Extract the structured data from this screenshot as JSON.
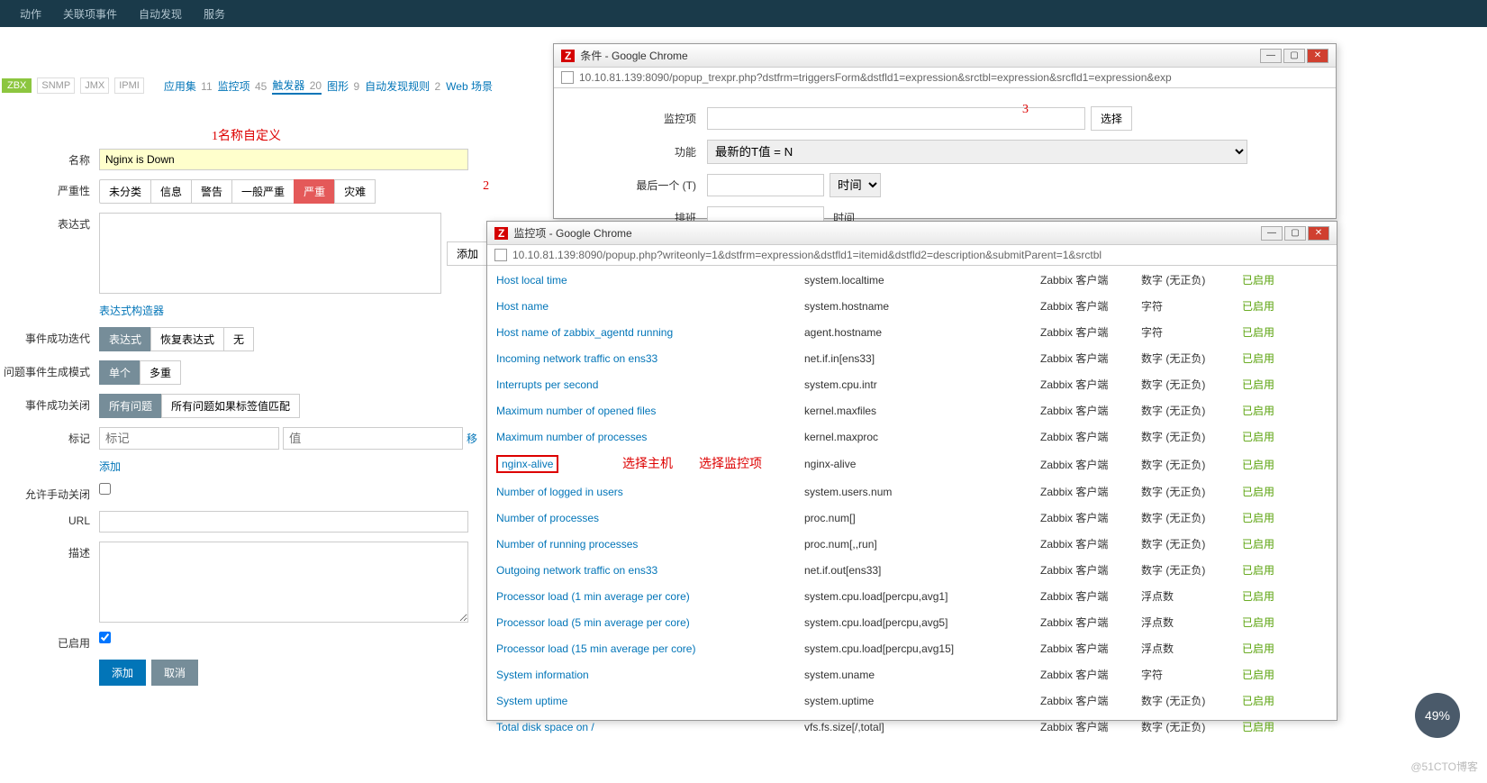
{
  "top_nav": {
    "items": [
      "动作",
      "关联项事件",
      "自动发现",
      "服务"
    ]
  },
  "sub_bar": {
    "zbx": "ZBX",
    "badges": [
      "SNMP",
      "JMX",
      "IPMI"
    ],
    "tabs": [
      {
        "label": "应用集",
        "count": "11"
      },
      {
        "label": "监控项",
        "count": "45"
      },
      {
        "label": "触发器",
        "count": "20"
      },
      {
        "label": "图形",
        "count": "9"
      },
      {
        "label": "自动发现规则",
        "count": "2"
      },
      {
        "label": "Web 场景",
        "count": ""
      }
    ]
  },
  "annotations": {
    "one": "1名称自定义",
    "two": "2",
    "three": "3",
    "sel_host": "选择主机",
    "sel_item": "选择监控项"
  },
  "form": {
    "labels": {
      "name": "名称",
      "severity": "严重性",
      "expression": "表达式",
      "expr_builder": "表达式构造器",
      "event_ok": "事件成功迭代",
      "problem_gen": "问题事件生成模式",
      "event_close": "事件成功关闭",
      "tags": "标记",
      "allow_manual": "允许手动关闭",
      "url": "URL",
      "desc": "描述",
      "enabled": "已启用"
    },
    "name_value": "Nginx is Down",
    "severity_opts": [
      "未分类",
      "信息",
      "警告",
      "一般严重",
      "严重",
      "灾难"
    ],
    "severity_selected": 4,
    "expr_add": "添加",
    "event_ok_opts": [
      "表达式",
      "恢复表达式",
      "无"
    ],
    "event_ok_sel": 0,
    "problem_opts": [
      "单个",
      "多重"
    ],
    "problem_sel": 0,
    "event_close_opts": [
      "所有问题",
      "所有问题如果标签值匹配"
    ],
    "event_close_sel": 0,
    "tag_placeholder1": "标记",
    "tag_placeholder2": "值",
    "tag_remove": "移",
    "add_link": "添加",
    "submit": "添加",
    "cancel": "取消"
  },
  "popup_cond": {
    "title": "条件 - Google Chrome",
    "url": "10.10.81.139:8090/popup_trexpr.php?dstfrm=triggersForm&dstfld1=expression&srctbl=expression&srcfld1=expression&exp",
    "labels": {
      "item": "监控项",
      "func": "功能",
      "last": "最后一个 (T)",
      "shift": "排班"
    },
    "select_btn": "选择",
    "func_value": "最新的T值 = N",
    "time_opt": "时间",
    "time_label": "时间"
  },
  "popup_items": {
    "title": "监控项 - Google Chrome",
    "url": "10.10.81.139:8090/popup.php?writeonly=1&dstfrm=expression&dstfld1=itemid&dstfld2=description&submitParent=1&srctbl",
    "enabled_label": "已启用",
    "rows": [
      {
        "name": "Host local time",
        "key": "system.localtime",
        "iface": "Zabbix 客户端",
        "type": "数字 (无正负)"
      },
      {
        "name": "Host name",
        "key": "system.hostname",
        "iface": "Zabbix 客户端",
        "type": "字符"
      },
      {
        "name": "Host name of zabbix_agentd running",
        "key": "agent.hostname",
        "iface": "Zabbix 客户端",
        "type": "字符"
      },
      {
        "name": "Incoming network traffic on ens33",
        "key": "net.if.in[ens33]",
        "iface": "Zabbix 客户端",
        "type": "数字 (无正负)"
      },
      {
        "name": "Interrupts per second",
        "key": "system.cpu.intr",
        "iface": "Zabbix 客户端",
        "type": "数字 (无正负)"
      },
      {
        "name": "Maximum number of opened files",
        "key": "kernel.maxfiles",
        "iface": "Zabbix 客户端",
        "type": "数字 (无正负)"
      },
      {
        "name": "Maximum number of processes",
        "key": "kernel.maxproc",
        "iface": "Zabbix 客户端",
        "type": "数字 (无正负)"
      },
      {
        "name": "nginx-alive",
        "key": "nginx-alive",
        "iface": "Zabbix 客户端",
        "type": "数字 (无正负)",
        "highlight": true
      },
      {
        "name": "Number of logged in users",
        "key": "system.users.num",
        "iface": "Zabbix 客户端",
        "type": "数字 (无正负)"
      },
      {
        "name": "Number of processes",
        "key": "proc.num[]",
        "iface": "Zabbix 客户端",
        "type": "数字 (无正负)"
      },
      {
        "name": "Number of running processes",
        "key": "proc.num[,,run]",
        "iface": "Zabbix 客户端",
        "type": "数字 (无正负)"
      },
      {
        "name": "Outgoing network traffic on ens33",
        "key": "net.if.out[ens33]",
        "iface": "Zabbix 客户端",
        "type": "数字 (无正负)"
      },
      {
        "name": "Processor load (1 min average per core)",
        "key": "system.cpu.load[percpu,avg1]",
        "iface": "Zabbix 客户端",
        "type": "浮点数"
      },
      {
        "name": "Processor load (5 min average per core)",
        "key": "system.cpu.load[percpu,avg5]",
        "iface": "Zabbix 客户端",
        "type": "浮点数"
      },
      {
        "name": "Processor load (15 min average per core)",
        "key": "system.cpu.load[percpu,avg15]",
        "iface": "Zabbix 客户端",
        "type": "浮点数"
      },
      {
        "name": "System information",
        "key": "system.uname",
        "iface": "Zabbix 客户端",
        "type": "字符"
      },
      {
        "name": "System uptime",
        "key": "system.uptime",
        "iface": "Zabbix 客户端",
        "type": "数字 (无正负)"
      },
      {
        "name": "Total disk space on /",
        "key": "vfs.fs.size[/,total]",
        "iface": "Zabbix 客户端",
        "type": "数字 (无正负)"
      }
    ]
  },
  "circle": "49%",
  "watermark": "@51CTO博客"
}
